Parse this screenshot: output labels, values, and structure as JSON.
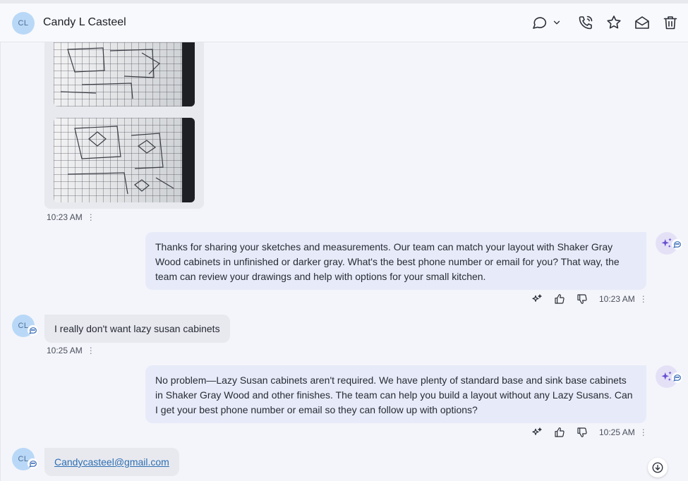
{
  "contact": {
    "initials": "CL",
    "name": "Candy L Casteel"
  },
  "header_icons": [
    "chat-bubble-dropdown-icon",
    "phone-icon",
    "star-icon",
    "envelope-icon",
    "trash-icon"
  ],
  "messages": [
    {
      "sender": "contact",
      "type": "images",
      "images": [
        "sketch-1",
        "sketch-2"
      ],
      "time": "10:23 AM"
    },
    {
      "sender": "agent",
      "text": "Thanks for sharing your sketches and measurements. Our team can match your layout with Shaker Gray Wood cabinets in unfinished or darker gray. What's the best phone number or email for you? That way, the team can review your drawings and help with options for your small kitchen.",
      "time": "10:23 AM"
    },
    {
      "sender": "contact",
      "text": "I really don't want lazy susan cabinets",
      "time": "10:25 AM"
    },
    {
      "sender": "agent",
      "text": "No problem—Lazy Susan cabinets aren't required. We have plenty of standard base and sink base cabinets in Shaker Gray Wood and other finishes. The team can help you build a layout without any Lazy Susans. Can I get your best phone number or email so they can follow up with options?",
      "time": "10:25 AM"
    },
    {
      "sender": "contact",
      "text": "Candycasteel@gmail.com",
      "is_link": true
    }
  ],
  "more_glyph": "⋮",
  "colors": {
    "accent_purple": "#6a4fd0",
    "link": "#2d6fb3",
    "avatar_bg": "#b9d8f7"
  }
}
